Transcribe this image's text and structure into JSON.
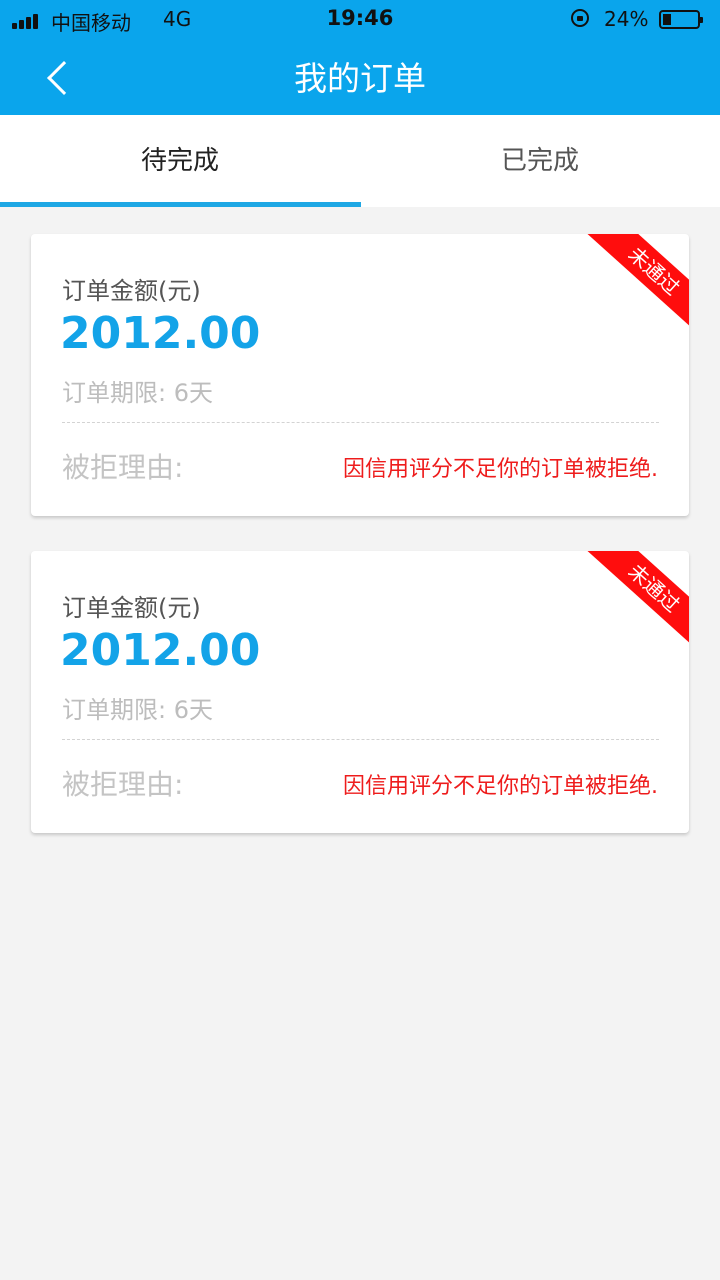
{
  "status_bar": {
    "carrier": "中国移动",
    "network": "4G",
    "time": "19:46",
    "battery_percent": "24%",
    "battery_level": 0.24,
    "icons": [
      "signal-icon",
      "rotation-lock-icon",
      "battery-icon"
    ]
  },
  "nav": {
    "title": "我的订单",
    "back_icon": "chevron-left-icon"
  },
  "tabs": [
    {
      "label": "待完成",
      "active": true
    },
    {
      "label": "已完成",
      "active": false
    }
  ],
  "colors": {
    "primary": "#0aa5ec",
    "amount": "#13a3e8",
    "reject": "#ff0d0d"
  },
  "orders": [
    {
      "amount_label": "订单金额(元)",
      "amount": "2012.00",
      "term": "订单期限: 6天",
      "reason_label": "被拒理由:",
      "reason": "因信用评分不足你的订单被拒绝.",
      "status": "未通过"
    },
    {
      "amount_label": "订单金额(元)",
      "amount": "2012.00",
      "term": "订单期限: 6天",
      "reason_label": "被拒理由:",
      "reason": "因信用评分不足你的订单被拒绝.",
      "status": "未通过"
    }
  ]
}
